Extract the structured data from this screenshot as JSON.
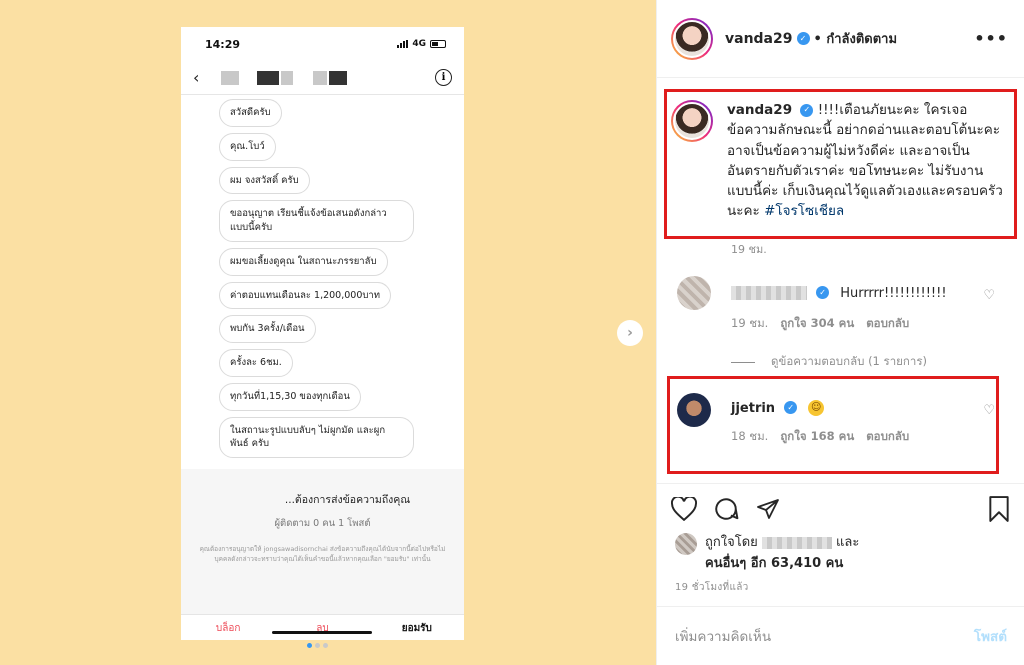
{
  "phone": {
    "time": "14:29",
    "network": "4G",
    "messages": [
      "สวัสดีครับ",
      "คุณ.โบว์",
      "ผม จงสวัสดิ์ ครับ",
      "ขออนุญาต เรียนชี้แจ้งข้อเสนอดังกล่าว แบบนี้ครับ",
      "ผมขอเลี้ยงดูคุณ ในสถานะภรรยาลับ",
      "ค่าตอบแทนเดือนละ 1,200,000บาท",
      "พบกัน 3ครั้ง/เดือน",
      "ครั้งละ 6ชม.",
      "ทุกวันที่1,15,30 ของทุกเดือน",
      "ในสถานะรูปแบบลับๆ ไม่ผูกมัด และผูก พันธ์ ครับ"
    ],
    "request_title": "...ต้องการส่งข้อความถึงคุณ",
    "request_sub": "ผู้ติดตาม 0 คน 1 โพสต์",
    "request_small": "คุณต้องการอนุญาตให้ jongsawadisornchai ส่งข้อความถึงคุณได้นับจากนี้ต่อไปหรือไม่ บุคคลดังกล่าวจะทราบว่าคุณได้เห็นคำขอนี้แล้วหากคุณเลือก \"ยอมรับ\" เท่านั้น",
    "block_label": "บล็อก",
    "delete_label": "ลบ",
    "accept_label": "ยอมรับ"
  },
  "post": {
    "username": "vanda29",
    "following_label": "กำลังติดตาม",
    "caption": "!!!!เตือนภัยนะคะ ใครเจอข้อความลักษณะนี้ อย่ากดอ่านและตอบโต้นะคะ อาจเป็นข้อความผู้ไม่หวังดีค่ะ และอาจเป็นอันตรายกับตัวเราค่ะ ขอโทษนะคะ ไม่รับงานแบบนี้ค่ะ เก็บเงินคุณไว้ดูแลตัวเองและครอบครัวนะคะ",
    "hashtag": "#โจรโซเชียล",
    "caption_time": "19 ชม.",
    "comment1_text": "Hurrrrr!!!!!!!!!!!!",
    "comment1_time": "19 ชม.",
    "comment1_likes": "ถูกใจ 304 คน",
    "reply_label": "ตอบกลับ",
    "view_replies": "ดูข้อความตอบกลับ (1 รายการ)",
    "comment2_user": "jjetrin",
    "comment2_time": "18 ชม.",
    "comment2_likes": "ถูกใจ 168 คน",
    "likes_line1": "ถูกใจโดย",
    "likes_and": "และ",
    "likes_line2": "คนอื่นๆ อีก 63,410 คน",
    "time_ago": "19 ชั่วโมงที่แล้ว",
    "add_comment": "เพิ่มความคิดเห็น",
    "post_button": "โพสต์"
  },
  "icons": [
    "back-icon",
    "info-icon",
    "next-arrow-icon",
    "verified-icon",
    "more-icon",
    "heart-icon",
    "comment-icon",
    "share-icon",
    "bookmark-icon"
  ]
}
